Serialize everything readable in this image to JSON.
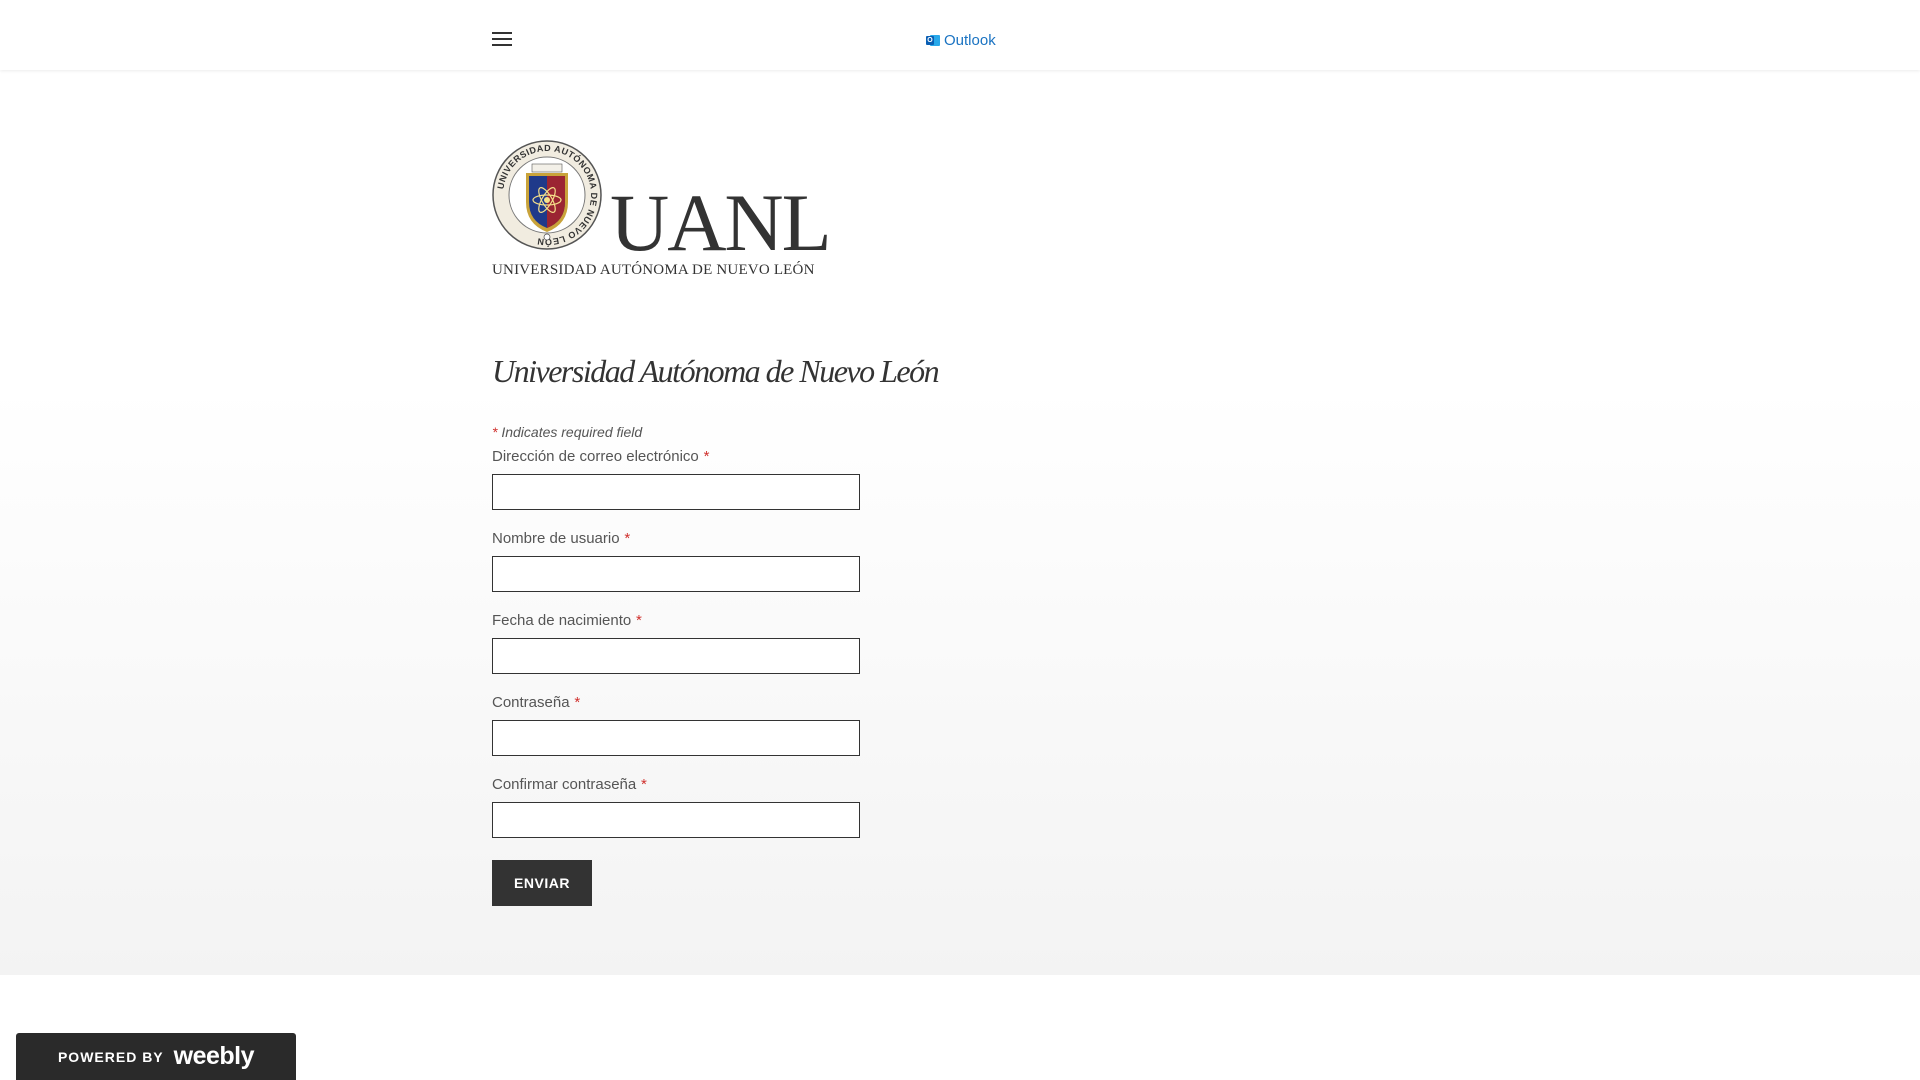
{
  "header": {
    "menu_icon": "hamburger-icon",
    "nav_link": {
      "icon": "outlook-icon",
      "label": "Outlook"
    }
  },
  "logo": {
    "wordmark": "UANL",
    "subtitle": "UNIVERSIDAD AUTÓNOMA DE NUEVO LEÓN",
    "seal_text": "UNIVERSIDAD AUTÓNOMA DE NUEVO LEÓN",
    "colors": {
      "shield_blue": "#1f3a8a",
      "shield_red": "#b22222",
      "gold": "#c9a33a"
    }
  },
  "page_title": "Universidad Autónoma de Nuevo León",
  "form": {
    "required_marker": "*",
    "required_note": "Indicates required field",
    "fields": [
      {
        "label": "Dirección de correo electrónico",
        "value": ""
      },
      {
        "label": "Nombre de usuario",
        "value": ""
      },
      {
        "label": "Fecha de nacimiento",
        "value": ""
      },
      {
        "label": "Contraseña",
        "value": ""
      },
      {
        "label": "Confirmar contraseña",
        "value": ""
      }
    ],
    "submit_label": "ENVIAR"
  },
  "footer": {
    "badge_prefix": "POWERED BY",
    "badge_brand": "weebly"
  },
  "colors": {
    "link": "#1a73c2",
    "required": "#d0302d",
    "button": "#333333",
    "badge": "#2a2a2a"
  }
}
